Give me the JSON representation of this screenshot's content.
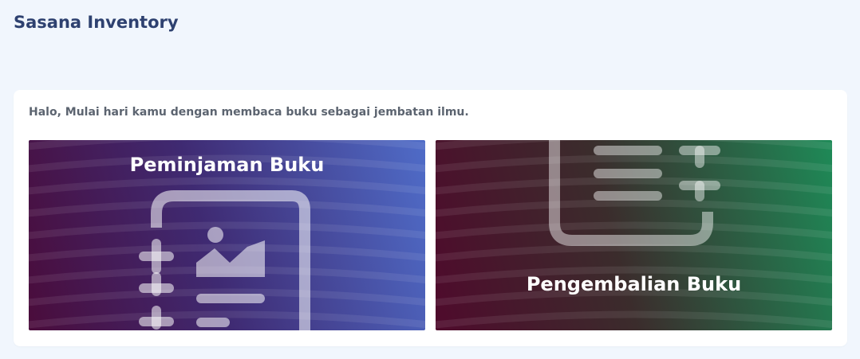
{
  "app": {
    "title": "Sasana Inventory"
  },
  "main": {
    "greeting": "Halo, Mulai hari kamu dengan membaca buku sebagai jembatan ilmu.",
    "cards": [
      {
        "label": "Peminjaman Buku",
        "icon": "document-image-icon",
        "color_start": "#4a0c3b",
        "color_end": "#4f6cc8"
      },
      {
        "label": "Pengembalian Buku",
        "icon": "document-list-icon",
        "color_start": "#4f0a2c",
        "color_end": "#1e8a57"
      }
    ]
  }
}
